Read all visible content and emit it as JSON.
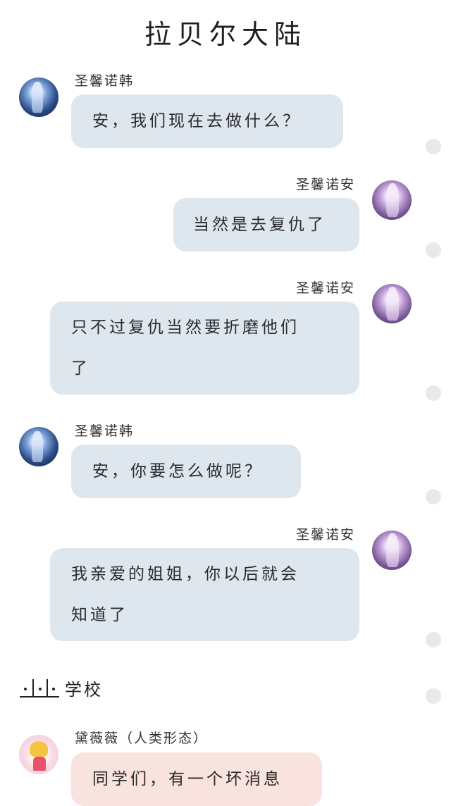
{
  "header": {
    "title": "拉贝尔大陆"
  },
  "messages": [
    {
      "sender": "圣馨诺韩",
      "text": "安，我们现在去做什么？",
      "side": "left",
      "avatar": "blue-haired-girl-avatar"
    },
    {
      "sender": "圣馨诺安",
      "text": "当然是去复仇了",
      "side": "right",
      "avatar": "purple-haired-girl-avatar"
    },
    {
      "sender": "圣馨诺安",
      "lines": [
        "只不过复仇当然要折磨他们",
        "了"
      ],
      "side": "right",
      "avatar": "purple-haired-girl-avatar"
    },
    {
      "sender": "圣馨诺韩",
      "text": "安，你要怎么做呢？",
      "side": "left",
      "avatar": "blue-haired-girl-avatar"
    },
    {
      "sender": "圣馨诺安",
      "lines": [
        "我亲爱的姐姐，你以后就会",
        "知道了"
      ],
      "side": "right",
      "avatar": "purple-haired-girl-avatar"
    },
    {
      "sender": "黛薇薇（人类形态）",
      "text": "同学们，有一个坏消息",
      "side": "left",
      "avatar": "blonde-girl-avatar"
    }
  ],
  "scene": {
    "label": "学校"
  },
  "colors": {
    "bubble_blue": "#dfe7ee",
    "bubble_pink": "#f8e3df",
    "dot": "#e9e9e9"
  }
}
